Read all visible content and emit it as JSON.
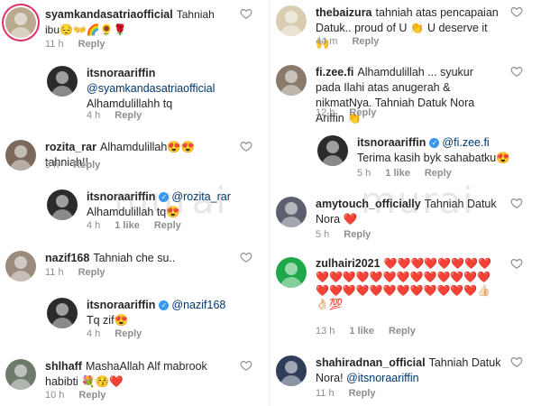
{
  "labels": {
    "reply": "Reply"
  },
  "watermark": "murai",
  "left": [
    {
      "user": "syamkandasatriaofficial",
      "text": "Tahniah ibu😔👐🌈🌻🌹",
      "time": "11 h",
      "likes": "",
      "avatar_color": "#b9a98f",
      "story": true
    },
    {
      "user": "itsnoraariffin",
      "mention": "@syamkandasatriaofficial",
      "text": "Alhamdulillahh tq",
      "time": "4 h",
      "likes": "",
      "avatar_color": "#2b2b2b",
      "reply": true
    },
    {
      "user": "rozita_rar",
      "text": "Alhamdulillah😍😍 tahniah!!",
      "time": "5 h",
      "likes": "",
      "avatar_color": "#7b6a5c"
    },
    {
      "user": "itsnoraariffin",
      "verified": true,
      "mention": "@rozita_rar",
      "text": "Alhamdulillah tq😍",
      "time": "4 h",
      "likes": "1 like",
      "avatar_color": "#2b2b2b",
      "reply": true
    },
    {
      "user": "nazif168",
      "text": "Tahniah che su..",
      "time": "11 h",
      "likes": "",
      "avatar_color": "#9a8b7d"
    },
    {
      "user": "itsnoraariffin",
      "verified": true,
      "mention": "@nazif168",
      "text": "Tq zif😍",
      "time": "4 h",
      "likes": "",
      "avatar_color": "#2b2b2b",
      "reply": true
    },
    {
      "user": "shlhaff",
      "text": "MashaAllah Alf mabrook habibti 💐😚❤️",
      "time": "10 h",
      "likes": "",
      "avatar_color": "#6f7b6a"
    }
  ],
  "right": [
    {
      "user": "thebaizura",
      "text": "tahniah atas pencapaian Datuk.. proud of U 👏 U deserve it🙌",
      "time": "44 m",
      "likes": "",
      "avatar_color": "#d8cdb0"
    },
    {
      "user": "fi.zee.fi",
      "text": "Alhamdulillah ... syukur pada Ilahi atas anugerah & nikmatNya. Tahniah Datuk Nora Ariffin 👏",
      "time": "12 h",
      "likes": "",
      "avatar_color": "#8a7a6b"
    },
    {
      "user": "itsnoraariffin",
      "verified": true,
      "mention": "@fi.zee.fi",
      "text": "Terima kasih byk sahabatku😍",
      "time": "5 h",
      "likes": "1 like",
      "avatar_color": "#2b2b2b",
      "reply": true
    },
    {
      "user": "amytouch_officially",
      "text": "Tahniah Datuk Nora ❤️",
      "time": "5 h",
      "likes": "",
      "avatar_color": "#5b5f6e"
    },
    {
      "user": "zulhairi2021",
      "text": "❤️❤️❤️❤️❤️❤️❤️❤️❤️❤️❤️❤️❤️❤️❤️❤️❤️❤️❤️❤️❤️❤️❤️❤️❤️❤️❤️❤️❤️❤️❤️❤️❤️👍🏻👌🏻💯",
      "time": "13 h",
      "likes": "1 like",
      "avatar_color": "#1fa84a"
    },
    {
      "user": "shahiradnan_official",
      "mention": "@itsnoraariffin",
      "text": "Tahniah Datuk Nora!",
      "time": "11 h",
      "likes": "",
      "avatar_color": "#2f3d59"
    }
  ]
}
